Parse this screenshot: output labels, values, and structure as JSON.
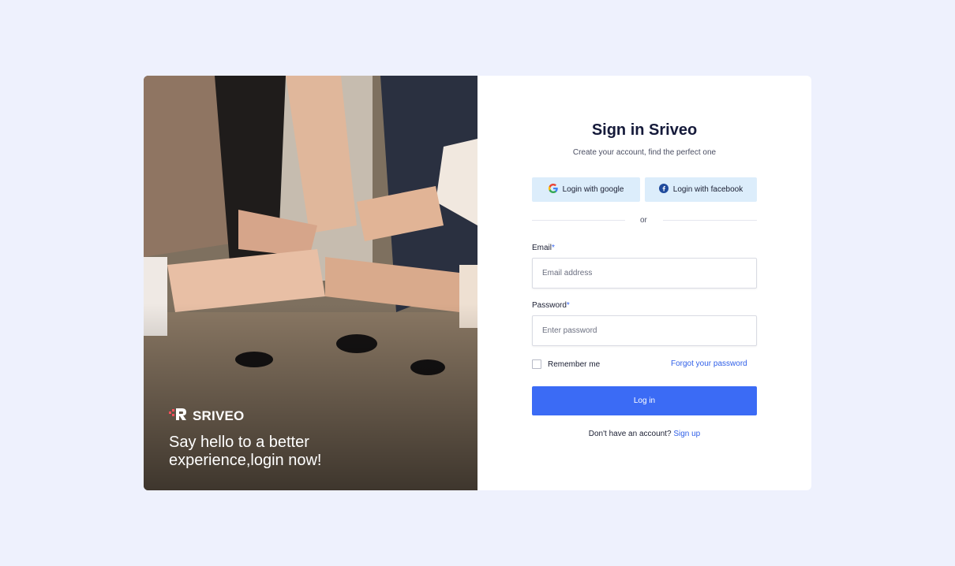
{
  "hero": {
    "brand_name": "SRIVEO",
    "tagline": "Say hello to a better experience,login now!"
  },
  "form": {
    "title": "Sign in Sriveo",
    "subtitle": "Create your account, find the perfect one",
    "google_label": "Login with google",
    "facebook_label": "Login with facebook",
    "divider_text": "or",
    "email_label": "Email",
    "email_placeholder": "Email address",
    "password_label": "Password",
    "password_placeholder": "Enter password",
    "required_marker": "*",
    "remember_label": "Remember me",
    "forgot_label": "Forgot your password",
    "login_label": "Log in",
    "signup_prompt": "Don't have an account?",
    "signup_link": "Sign up"
  },
  "colors": {
    "background": "#eef1fd",
    "primary": "#3b6bf5",
    "social_button": "#dcedfb",
    "link": "#2f5fe8"
  },
  "icons": {
    "google": "google-icon",
    "facebook": "facebook-icon",
    "logo": "sriveo-logo-icon"
  }
}
